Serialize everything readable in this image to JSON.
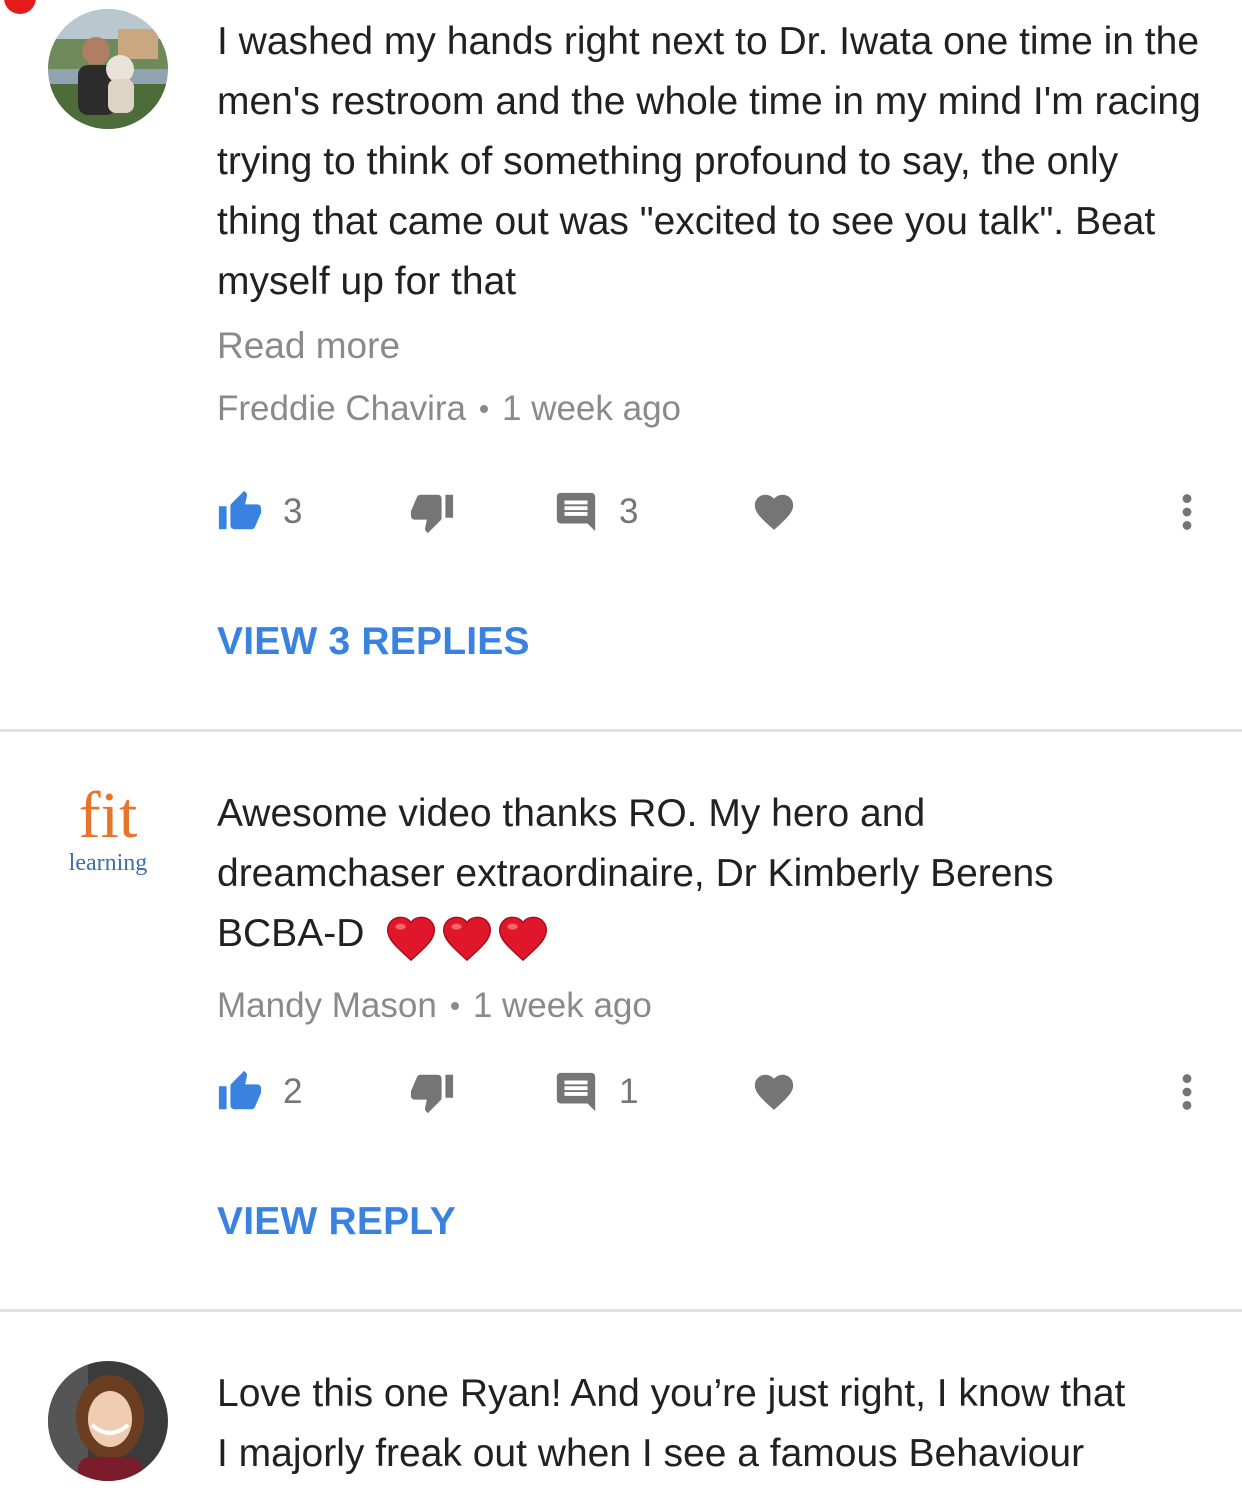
{
  "comments": [
    {
      "text": "I washed my hands right next to Dr. Iwata one time in the men's restroom and the whole time in my mind I'm racing trying to think of something profound to say, the only thing that came out was \"excited to see you talk\". Beat myself up for that",
      "read_more": "Read more",
      "author": "Freddie Chavira",
      "time": "1 week ago",
      "likes": "3",
      "replies_count": "3",
      "view_replies": "VIEW 3 REPLIES"
    },
    {
      "text_line1": "Awesome video thanks RO. My hero and",
      "text_line2": "dreamchaser extraordinaire, Dr Kimberly Berens",
      "text_line3": "BCBA-D",
      "avatar_logo_main": "fit",
      "avatar_logo_sub": "learning",
      "author": "Mandy Mason",
      "time": "1 week ago",
      "likes": "2",
      "replies_count": "1",
      "view_replies": "VIEW REPLY"
    },
    {
      "text_line1": "Love this one Ryan! And you’re just right, I know that",
      "text_line2": "I majorly freak out when I see a famous Behaviour"
    }
  ],
  "colors": {
    "link_blue": "#3a82e0",
    "like_active_blue": "#3a82e0",
    "icon_gray": "#757575",
    "meta_gray": "#8a8a8a",
    "heart_emoji_red": "#e0162b",
    "fit_orange": "#e8742a",
    "fit_blue": "#3b6fa8"
  },
  "icons": {
    "like": "thumbs-up-icon",
    "dislike": "thumbs-down-icon",
    "reply": "comment-icon",
    "heart": "heart-icon",
    "more": "more-vert-icon"
  }
}
